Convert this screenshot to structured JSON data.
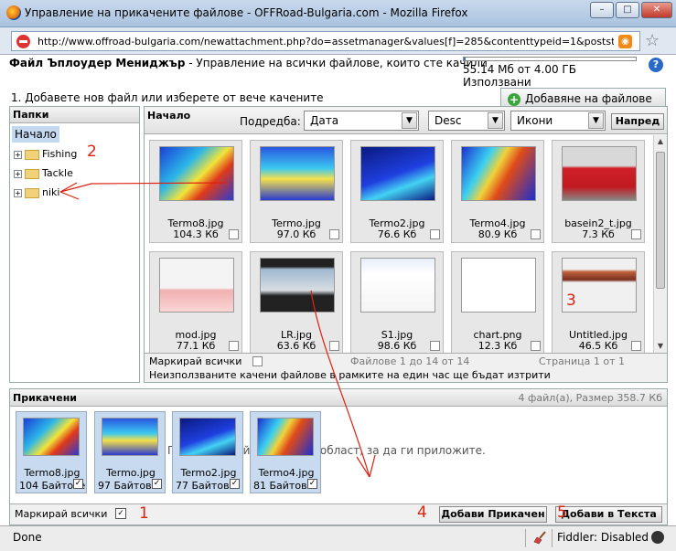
{
  "window": {
    "title": "Управление на прикачените файлове - OFFRoad-Bulgaria.com - Mozilla Firefox",
    "minimize": "–",
    "maximize": "□",
    "close": "✕"
  },
  "urlbar": {
    "url": "http://www.offroad-bulgaria.com/newattachment.php?do=assetmanager&values[f]=285&contenttypeid=1&poststarttir"
  },
  "header": {
    "app_name": "Файл Ъплоудер Мениджър",
    "separator": "-",
    "description": "Управление на всички файлове, които сте качили",
    "quota_text": "55.14 Мб от 4.00 ГБ Използвани",
    "quota_fraction": 0.013,
    "help": "?"
  },
  "step": "1. Добавете нов файл или изберете от вече качените",
  "add_files_label": "Добавяне на файлове",
  "folders": {
    "heading": "Папки",
    "root": "Начало",
    "items": [
      {
        "label": "Fishing",
        "expander": "+"
      },
      {
        "label": "Tackle",
        "expander": "+"
      },
      {
        "label": "niki",
        "expander": "+"
      }
    ]
  },
  "files": {
    "crumb": "Начало",
    "sort_label": "Подредба:",
    "sort_by": "Дата",
    "sort_order": "Desc",
    "view": "Икони",
    "next_label": "Напред",
    "items": [
      {
        "name": "Termo8.jpg",
        "size": "104.3 Кб",
        "thumb": "thermal-red"
      },
      {
        "name": "Termo.jpg",
        "size": "97.0 Кб",
        "thumb": "thermal-house"
      },
      {
        "name": "Termo2.jpg",
        "size": "76.6 Кб",
        "thumb": "thermal-dark"
      },
      {
        "name": "Termo4.jpg",
        "size": "80.9 Кб",
        "thumb": "thermal-pipes"
      },
      {
        "name": "basein2_t.jpg",
        "size": "7.3 Кб",
        "thumb": "pool"
      },
      {
        "name": "mod.jpg",
        "size": "77.1 Кб",
        "thumb": "web-page"
      },
      {
        "name": "LR.jpg",
        "size": "63.6 Кб",
        "thumb": "car-slide"
      },
      {
        "name": "S1.jpg",
        "size": "98.6 Кб",
        "thumb": "form-page"
      },
      {
        "name": "chart.png",
        "size": "12.3 Кб",
        "thumb": "chart"
      },
      {
        "name": "Untitled.jpg",
        "size": "46.5 Кб",
        "thumb": "banner"
      }
    ],
    "mark_all": "Маркирай всички",
    "range_text": "Файлове 1 до 14 от 14",
    "page_text": "Страница 1 от 1",
    "warning": "Неизползваните качени файлове в рамките на един час ще бъдат изтрити"
  },
  "attached": {
    "heading": "Прикачени",
    "summary": "4 файл(а), Размер 358.7 Кб",
    "drop_hint": "Плъзнете файлове в тази област, за да ги приложите.",
    "items": [
      {
        "name": "Termo8.jpg",
        "size": "104 Байтове",
        "thumb": "thermal-red",
        "checked": "✓"
      },
      {
        "name": "Termo.jpg",
        "size": "97 Байтове",
        "thumb": "thermal-house",
        "checked": "✓"
      },
      {
        "name": "Termo2.jpg",
        "size": "77 Байтове",
        "thumb": "thermal-dark",
        "checked": "✓"
      },
      {
        "name": "Termo4.jpg",
        "size": "81 Байтове",
        "thumb": "thermal-pipes",
        "checked": "✓"
      }
    ],
    "mark_all": "Маркирай всички",
    "mark_all_checked": "✓",
    "attach_button": "Добави Прикачен",
    "insert_button": "Добави в Текста"
  },
  "status": {
    "text": "Done",
    "fiddler": "Fiddler: Disabled"
  },
  "annotations": [
    "1",
    "2",
    "3",
    "4",
    "5"
  ],
  "colors": {
    "annotation": "#dd1111",
    "selection": "#c4d8f0",
    "quota_fill": "#3a6fc4"
  }
}
